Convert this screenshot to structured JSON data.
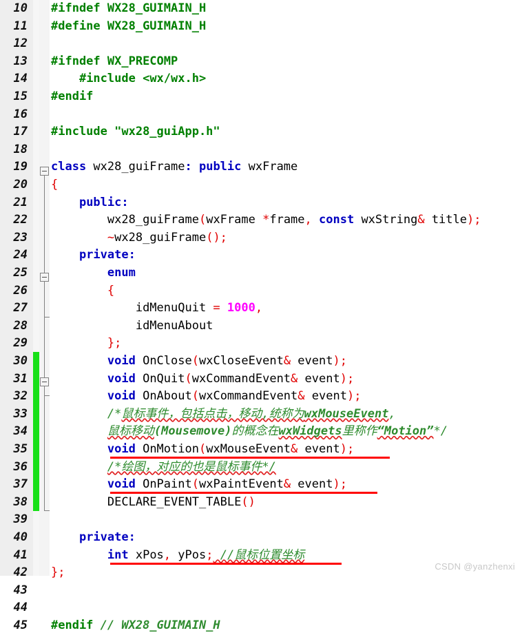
{
  "editor": {
    "language": "C++",
    "first_line": 10,
    "last_line": 45,
    "line_height_px": 25.6,
    "colors": {
      "background": "#ffffff",
      "gutter": "#eeeeee",
      "line_number": "#111111",
      "preprocessor": "#008000",
      "keyword": "#0000c0",
      "punctuation": "#e00000",
      "number": "#ff00ff",
      "identifier": "#000000",
      "comment": "#2e8b2e",
      "change_bar": "#18e018",
      "annotation_underline": "#ff0000",
      "spellcheck_squiggle": "#e02020",
      "watermark": "#c8c8c8"
    }
  },
  "line_numbers": [
    "10",
    "11",
    "12",
    "13",
    "14",
    "15",
    "16",
    "17",
    "18",
    "19",
    "20",
    "21",
    "22",
    "23",
    "24",
    "25",
    "26",
    "27",
    "28",
    "29",
    "30",
    "31",
    "32",
    "33",
    "34",
    "35",
    "36",
    "37",
    "38",
    "39",
    "40",
    "41",
    "42",
    "43",
    "44",
    "45"
  ],
  "code": {
    "l10": {
      "pre": "#ifndef",
      "rest": " WX28_GUIMAIN_H"
    },
    "l11": {
      "pre": "#define",
      "rest": " WX28_GUIMAIN_H"
    },
    "l12": {
      "text": ""
    },
    "l13": {
      "pre": "#ifndef",
      "rest": " WX_PRECOMP"
    },
    "l14": {
      "indent": "    ",
      "pre": "#include",
      "rest": " <wx/wx.h>"
    },
    "l15": {
      "pre": "#endif",
      "rest": ""
    },
    "l16": {
      "text": ""
    },
    "l17": {
      "pre": "#include",
      "rest": " \"wx28_guiApp.h\""
    },
    "l18": {
      "text": ""
    },
    "l19": {
      "kw1": "class",
      "id1": " wx28_guiFrame",
      "p1": ":",
      "kw2": " public",
      "id2": " wxFrame"
    },
    "l20": {
      "brace": "{"
    },
    "l21": {
      "indent": "    ",
      "kw": "public",
      "p": ":"
    },
    "l22": {
      "indent": "        ",
      "id1": "wx28_guiFrame",
      "p1": "(",
      "id2": "wxFrame ",
      "p2": "*",
      "id3": "frame",
      "p3": ",",
      "kw1": " const",
      "id4": " wxString",
      "p4": "&",
      "id5": " title",
      "p5": ");"
    },
    "l23": {
      "indent": "        ",
      "p1": "~",
      "id1": "wx28_guiFrame",
      "p2": "();"
    },
    "l24": {
      "indent": "    ",
      "kw": "private",
      "p": ":"
    },
    "l25": {
      "indent": "        ",
      "kw": "enum"
    },
    "l26": {
      "indent": "        ",
      "brace": "{"
    },
    "l27": {
      "indent": "            ",
      "id1": "idMenuQuit ",
      "p1": "=",
      "num": " 1000",
      "p2": ","
    },
    "l28": {
      "indent": "            ",
      "id1": "idMenuAbout"
    },
    "l29": {
      "indent": "        ",
      "p": "};"
    },
    "l30": {
      "indent": "        ",
      "kw": "void",
      "id1": " OnClose",
      "p1": "(",
      "id2": "wxCloseEvent",
      "p2": "&",
      "id3": " event",
      "p3": ");"
    },
    "l31": {
      "indent": "        ",
      "kw": "void",
      "id1": " OnQuit",
      "p1": "(",
      "id2": "wxCommandEvent",
      "p2": "&",
      "id3": " event",
      "p3": ");"
    },
    "l32": {
      "indent": "        ",
      "kw": "void",
      "id1": " OnAbout",
      "p1": "(",
      "id2": "wxCommandEvent",
      "p2": "&",
      "id3": " event",
      "p3": ");"
    },
    "l33": {
      "indent": "        ",
      "open": "/*",
      "cjk1": "鼠标事件，包括点击，移动,统称为",
      "latin1": "wxMouseEvent",
      "tail": ","
    },
    "l34": {
      "indent": "        ",
      "cjk1": "鼠标移动",
      "latin1": "(Mousemove)",
      "cjk2": "的概念在",
      "latin2": "wxWidgets",
      "cjk3": "里称作",
      "quoted": "“Motion”",
      "close": "*/"
    },
    "l35": {
      "indent": "        ",
      "kw": "void",
      "id1": " OnMotion",
      "p1": "(",
      "id2": "wxMouseEvent",
      "p2": "&",
      "id3": " event",
      "p3": ");"
    },
    "l36": {
      "indent": "        ",
      "comment": "/*绘图，对应的也是鼠标事件*/"
    },
    "l37": {
      "indent": "        ",
      "kw": "void",
      "id1": " OnPaint",
      "p1": "(",
      "id2": "wxPaintEvent",
      "p2": "&",
      "id3": " event",
      "p3": ");"
    },
    "l38": {
      "indent": "        ",
      "id1": "DECLARE_EVENT_TABLE",
      "p1": "()"
    },
    "l39": {
      "text": ""
    },
    "l40": {
      "indent": "    ",
      "kw": "private",
      "p": ":"
    },
    "l41": {
      "indent": "        ",
      "kw": "int",
      "id1": " xPos",
      "p1": ",",
      "id2": " yPos",
      "p2": ";",
      "comment": " //鼠标位置坐标"
    },
    "l42": {
      "p": "};"
    },
    "l43": {
      "text": ""
    },
    "l44": {
      "text": ""
    },
    "l45": {
      "pre": "#endif",
      "comment": " // WX28_GUIMAIN_H"
    }
  },
  "annotations": {
    "red_underlines": [
      {
        "line": 35,
        "note": "void OnMotion(wxMouseEvent& event);"
      },
      {
        "line": 37,
        "note": "void OnPaint(wxPaintEvent& event);"
      },
      {
        "line": 41,
        "note": "int xPos, yPos;"
      }
    ],
    "change_bar_lines": "32-41",
    "fold_boxes": [
      20,
      26,
      33
    ]
  },
  "watermark": {
    "text": "CSDN @yanzhenxi"
  }
}
